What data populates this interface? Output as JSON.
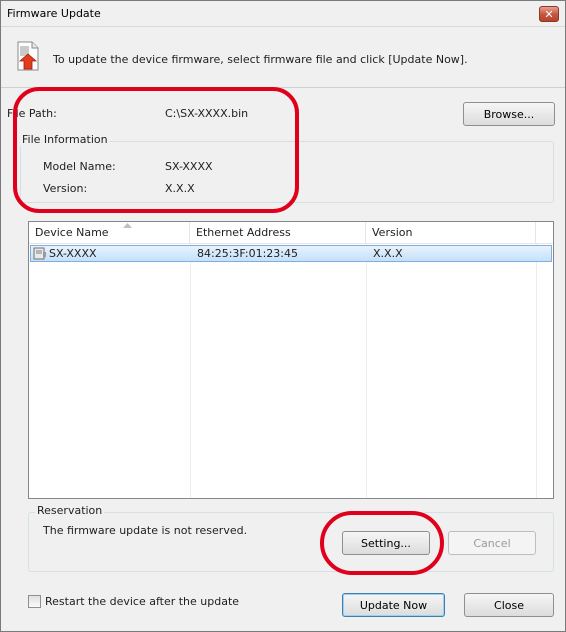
{
  "window": {
    "title": "Firmware Update",
    "close_glyph": "✕"
  },
  "header": {
    "icon": "document-upload-icon",
    "text": "To update the device firmware, select firmware file and click [Update Now]."
  },
  "file": {
    "path_label": "File Path:",
    "path_value": "C:\\SX-XXXX.bin",
    "browse_label": "Browse..."
  },
  "file_info": {
    "title": "File Information",
    "model_label": "Model Name:",
    "model_value": "SX-XXXX",
    "version_label": "Version:",
    "version_value": "X.X.X"
  },
  "device_list": {
    "columns": [
      "Device Name",
      "Ethernet Address",
      "Version"
    ],
    "rows": [
      {
        "name": "SX-XXXX",
        "ethernet": "84:25:3F:01:23:45",
        "version": "X.X.X",
        "selected": true
      }
    ]
  },
  "reservation": {
    "title": "Reservation",
    "status": "The firmware update is not reserved.",
    "setting_label": "Setting...",
    "cancel_label": "Cancel"
  },
  "footer": {
    "restart_label": "Restart the device after the update",
    "restart_checked": false,
    "update_label": "Update Now",
    "close_label": "Close"
  },
  "colors": {
    "annotation": "#e0001b",
    "selection": "#c4e0fb",
    "accent": "#3c7fb1"
  }
}
